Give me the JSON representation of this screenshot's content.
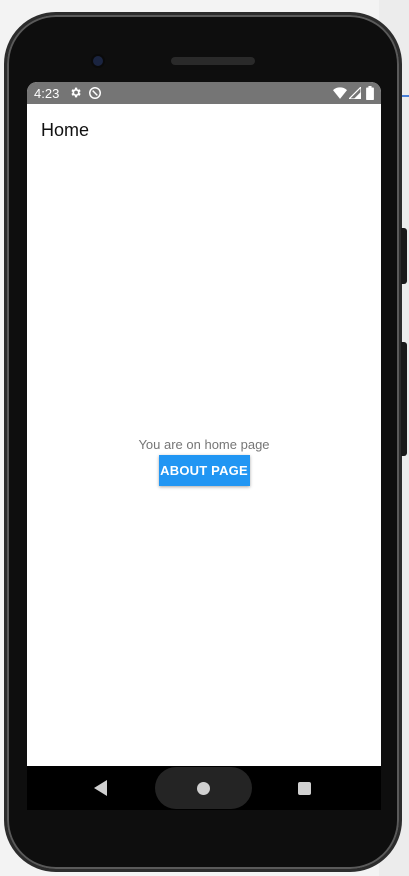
{
  "statusbar": {
    "time": "4:23",
    "icons": [
      "gear-icon",
      "sync-icon",
      "wifi-icon",
      "signal-icon",
      "battery-icon"
    ]
  },
  "page": {
    "title": "Home",
    "message": "You are on home page",
    "about_button_label": "ABOUT PAGE"
  },
  "navbar": {
    "icons": [
      "back-icon",
      "home-icon",
      "recents-icon"
    ]
  },
  "colors": {
    "statusbar_bg": "#757575",
    "accent_button": "#2196f3",
    "screen_bg": "#ffffff",
    "device_body": "#0e0e0e"
  }
}
